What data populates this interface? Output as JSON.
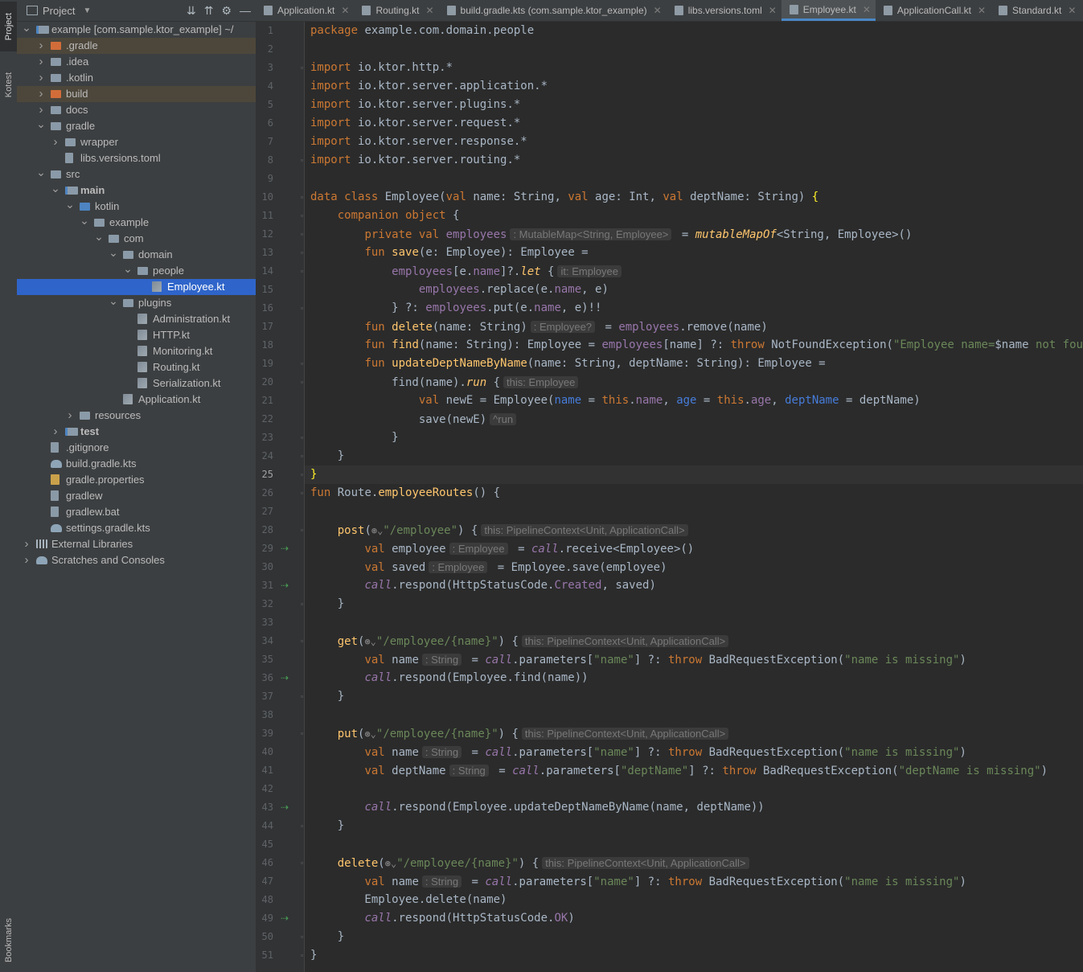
{
  "side_tabs": {
    "project": "Project",
    "kotest": "Kotest",
    "bookmarks": "Bookmarks"
  },
  "project_panel": {
    "title": "Project",
    "tree": [
      {
        "label": "example [com.sample.ktor_example]  ~/",
        "depth": 0,
        "arrow": "open",
        "icon": "module"
      },
      {
        "label": ".gradle",
        "depth": 1,
        "arrow": "closed",
        "icon": "folder-excluded",
        "excluded": true
      },
      {
        "label": ".idea",
        "depth": 1,
        "arrow": "closed",
        "icon": "folder"
      },
      {
        "label": ".kotlin",
        "depth": 1,
        "arrow": "closed",
        "icon": "folder"
      },
      {
        "label": "build",
        "depth": 1,
        "arrow": "closed",
        "icon": "folder-excluded",
        "excluded": true
      },
      {
        "label": "docs",
        "depth": 1,
        "arrow": "closed",
        "icon": "folder"
      },
      {
        "label": "gradle",
        "depth": 1,
        "arrow": "open",
        "icon": "folder"
      },
      {
        "label": "wrapper",
        "depth": 2,
        "arrow": "closed",
        "icon": "folder"
      },
      {
        "label": "libs.versions.toml",
        "depth": 2,
        "arrow": "none",
        "icon": "file"
      },
      {
        "label": "src",
        "depth": 1,
        "arrow": "open",
        "icon": "folder"
      },
      {
        "label": "main",
        "depth": 2,
        "arrow": "open",
        "icon": "folder-module",
        "bold": true
      },
      {
        "label": "kotlin",
        "depth": 3,
        "arrow": "open",
        "icon": "folder-source"
      },
      {
        "label": "example",
        "depth": 4,
        "arrow": "open",
        "icon": "folder"
      },
      {
        "label": "com",
        "depth": 5,
        "arrow": "open",
        "icon": "folder"
      },
      {
        "label": "domain",
        "depth": 6,
        "arrow": "open",
        "icon": "folder"
      },
      {
        "label": "people",
        "depth": 7,
        "arrow": "open",
        "icon": "folder"
      },
      {
        "label": "Employee.kt",
        "depth": 8,
        "arrow": "none",
        "icon": "kotlin-file",
        "selected": true
      },
      {
        "label": "plugins",
        "depth": 6,
        "arrow": "open",
        "icon": "folder"
      },
      {
        "label": "Administration.kt",
        "depth": 7,
        "arrow": "none",
        "icon": "kotlin-file"
      },
      {
        "label": "HTTP.kt",
        "depth": 7,
        "arrow": "none",
        "icon": "kotlin-file"
      },
      {
        "label": "Monitoring.kt",
        "depth": 7,
        "arrow": "none",
        "icon": "kotlin-file"
      },
      {
        "label": "Routing.kt",
        "depth": 7,
        "arrow": "none",
        "icon": "kotlin-file"
      },
      {
        "label": "Serialization.kt",
        "depth": 7,
        "arrow": "none",
        "icon": "kotlin-file"
      },
      {
        "label": "Application.kt",
        "depth": 6,
        "arrow": "none",
        "icon": "kotlin-file"
      },
      {
        "label": "resources",
        "depth": 3,
        "arrow": "closed",
        "icon": "folder-resources"
      },
      {
        "label": "test",
        "depth": 2,
        "arrow": "closed",
        "icon": "folder-module",
        "bold": true
      },
      {
        "label": ".gitignore",
        "depth": 1,
        "arrow": "none",
        "icon": "file"
      },
      {
        "label": "build.gradle.kts",
        "depth": 1,
        "arrow": "none",
        "icon": "gradle-file"
      },
      {
        "label": "gradle.properties",
        "depth": 1,
        "arrow": "none",
        "icon": "properties-file"
      },
      {
        "label": "gradlew",
        "depth": 1,
        "arrow": "none",
        "icon": "file"
      },
      {
        "label": "gradlew.bat",
        "depth": 1,
        "arrow": "none",
        "icon": "file"
      },
      {
        "label": "settings.gradle.kts",
        "depth": 1,
        "arrow": "none",
        "icon": "gradle-file"
      },
      {
        "label": "External Libraries",
        "depth": 0,
        "arrow": "closed",
        "icon": "library"
      },
      {
        "label": "Scratches and Consoles",
        "depth": 0,
        "arrow": "closed",
        "icon": "scratches"
      }
    ]
  },
  "tabs": [
    {
      "label": "Application.kt",
      "active": false
    },
    {
      "label": "Routing.kt",
      "active": false
    },
    {
      "label": "build.gradle.kts (com.sample.ktor_example)",
      "active": false
    },
    {
      "label": "libs.versions.toml",
      "active": false
    },
    {
      "label": "Employee.kt",
      "active": true
    },
    {
      "label": "ApplicationCall.kt",
      "active": false
    },
    {
      "label": "Standard.kt",
      "active": false
    }
  ],
  "editor": {
    "current_line": 25,
    "run_lines": [
      29,
      31,
      36,
      43,
      49
    ],
    "fold_lines": [
      3,
      8,
      10,
      11,
      12,
      13,
      14,
      16,
      19,
      20,
      23,
      24,
      25,
      26,
      28,
      32,
      34,
      37,
      39,
      44,
      46,
      50,
      51
    ],
    "lines": [
      [
        [
          "kw",
          "package"
        ],
        [
          "t",
          " example.com.domain.people"
        ]
      ],
      [],
      [
        [
          "kw",
          "import"
        ],
        [
          "t",
          " io.ktor.http.*"
        ]
      ],
      [
        [
          "kw",
          "import"
        ],
        [
          "t",
          " io.ktor.server.application.*"
        ]
      ],
      [
        [
          "kw",
          "import"
        ],
        [
          "t",
          " io.ktor.server.plugins.*"
        ]
      ],
      [
        [
          "kw",
          "import"
        ],
        [
          "t",
          " io.ktor.server.request.*"
        ]
      ],
      [
        [
          "kw",
          "import"
        ],
        [
          "t",
          " io.ktor.server.response.*"
        ]
      ],
      [
        [
          "kw",
          "import"
        ],
        [
          "t",
          " io.ktor.server.routing.*"
        ]
      ],
      [],
      [
        [
          "kw",
          "data class"
        ],
        [
          "t",
          " Employee("
        ],
        [
          "kw",
          "val"
        ],
        [
          "t",
          " name: String, "
        ],
        [
          "kw",
          "val"
        ],
        [
          "t",
          " age: Int, "
        ],
        [
          "kw",
          "val"
        ],
        [
          "t",
          " deptName: String) "
        ],
        [
          "br",
          "{"
        ]
      ],
      [
        [
          "t",
          "    "
        ],
        [
          "kw",
          "companion object"
        ],
        [
          "t",
          " {"
        ]
      ],
      [
        [
          "t",
          "        "
        ],
        [
          "kw",
          "private val"
        ],
        [
          "t",
          " "
        ],
        [
          "field",
          "employees"
        ],
        [
          "hint",
          ": MutableMap<String, Employee>"
        ],
        [
          "t",
          " = "
        ],
        [
          "fnit",
          "mutableMapOf"
        ],
        [
          "t",
          "<String, Employee>()"
        ]
      ],
      [
        [
          "t",
          "        "
        ],
        [
          "kw",
          "fun"
        ],
        [
          "t",
          " "
        ],
        [
          "fn",
          "save"
        ],
        [
          "t",
          "(e: Employee): Employee ="
        ]
      ],
      [
        [
          "t",
          "            "
        ],
        [
          "field",
          "employees"
        ],
        [
          "t",
          "[e."
        ],
        [
          "field",
          "name"
        ],
        [
          "t",
          "]?."
        ],
        [
          "fnit",
          "let"
        ],
        [
          "t",
          " {"
        ],
        [
          "hint",
          "it: Employee"
        ]
      ],
      [
        [
          "t",
          "                "
        ],
        [
          "field",
          "employees"
        ],
        [
          "t",
          ".replace(e."
        ],
        [
          "field",
          "name"
        ],
        [
          "t",
          ", e)"
        ]
      ],
      [
        [
          "t",
          "            } ?: "
        ],
        [
          "field",
          "employees"
        ],
        [
          "t",
          ".put(e."
        ],
        [
          "field",
          "name"
        ],
        [
          "t",
          ", e)!!"
        ]
      ],
      [
        [
          "t",
          "        "
        ],
        [
          "kw",
          "fun"
        ],
        [
          "t",
          " "
        ],
        [
          "fn",
          "delete"
        ],
        [
          "t",
          "(name: String)"
        ],
        [
          "hint",
          ": Employee?"
        ],
        [
          "t",
          " = "
        ],
        [
          "field",
          "employees"
        ],
        [
          "t",
          ".remove(name)"
        ]
      ],
      [
        [
          "t",
          "        "
        ],
        [
          "kw",
          "fun"
        ],
        [
          "t",
          " "
        ],
        [
          "fn",
          "find"
        ],
        [
          "t",
          "(name: String): Employee = "
        ],
        [
          "field",
          "employees"
        ],
        [
          "t",
          "[name] ?: "
        ],
        [
          "kw",
          "throw"
        ],
        [
          "t",
          " NotFoundException("
        ],
        [
          "str",
          "\"Employee name="
        ],
        [
          "t",
          "$name"
        ],
        [
          "str",
          " not found\""
        ],
        [
          "t",
          ")"
        ]
      ],
      [
        [
          "t",
          "        "
        ],
        [
          "kw",
          "fun"
        ],
        [
          "t",
          " "
        ],
        [
          "fn",
          "updateDeptNameByName"
        ],
        [
          "t",
          "(name: String, deptName: String): Employee ="
        ]
      ],
      [
        [
          "t",
          "            find(name)."
        ],
        [
          "fnit",
          "run"
        ],
        [
          "t",
          " {"
        ],
        [
          "hint",
          "this: Employee"
        ]
      ],
      [
        [
          "t",
          "                "
        ],
        [
          "kw",
          "val"
        ],
        [
          "t",
          " newE = Employee("
        ],
        [
          "param",
          "name"
        ],
        [
          "t",
          " = "
        ],
        [
          "kw",
          "this"
        ],
        [
          "t",
          "."
        ],
        [
          "field",
          "name"
        ],
        [
          "t",
          ", "
        ],
        [
          "param",
          "age"
        ],
        [
          "t",
          " = "
        ],
        [
          "kw",
          "this"
        ],
        [
          "t",
          "."
        ],
        [
          "field",
          "age"
        ],
        [
          "t",
          ", "
        ],
        [
          "param",
          "deptName"
        ],
        [
          "t",
          " = deptName)"
        ]
      ],
      [
        [
          "t",
          "                save(newE)"
        ],
        [
          "hint",
          "^run"
        ]
      ],
      [
        [
          "t",
          "            }"
        ]
      ],
      [
        [
          "t",
          "    }"
        ]
      ],
      [
        [
          "br",
          "}"
        ]
      ],
      [
        [
          "kw",
          "fun"
        ],
        [
          "t",
          " Route."
        ],
        [
          "fn",
          "employeeRoutes"
        ],
        [
          "t",
          "() {"
        ]
      ],
      [],
      [
        [
          "t",
          "    "
        ],
        [
          "fn2",
          "post"
        ],
        [
          "t",
          "("
        ],
        [
          "globe",
          "⊛⌄"
        ],
        [
          "str",
          "\"/employee\""
        ],
        [
          "t",
          ") {"
        ],
        [
          "hint",
          "this: PipelineContext<Unit, ApplicationCall>"
        ]
      ],
      [
        [
          "t",
          "        "
        ],
        [
          "kw",
          "val"
        ],
        [
          "t",
          " employee"
        ],
        [
          "hint",
          ": Employee"
        ],
        [
          "t",
          " = "
        ],
        [
          "callit",
          "call"
        ],
        [
          "t",
          ".receive<Employee>()"
        ]
      ],
      [
        [
          "t",
          "        "
        ],
        [
          "kw",
          "val"
        ],
        [
          "t",
          " saved"
        ],
        [
          "hint",
          ": Employee"
        ],
        [
          "t",
          " = Employee.save(employee)"
        ]
      ],
      [
        [
          "t",
          "        "
        ],
        [
          "callit",
          "call"
        ],
        [
          "t",
          ".respond(HttpStatusCode."
        ],
        [
          "field",
          "Created"
        ],
        [
          "t",
          ", saved)"
        ]
      ],
      [
        [
          "t",
          "    }"
        ]
      ],
      [],
      [
        [
          "t",
          "    "
        ],
        [
          "fn2",
          "get"
        ],
        [
          "t",
          "("
        ],
        [
          "globe",
          "⊛⌄"
        ],
        [
          "str",
          "\"/employee/{name}\""
        ],
        [
          "t",
          ") {"
        ],
        [
          "hint",
          "this: PipelineContext<Unit, ApplicationCall>"
        ]
      ],
      [
        [
          "t",
          "        "
        ],
        [
          "kw",
          "val"
        ],
        [
          "t",
          " name"
        ],
        [
          "hint",
          ": String"
        ],
        [
          "t",
          " = "
        ],
        [
          "callit",
          "call"
        ],
        [
          "t",
          ".parameters["
        ],
        [
          "str",
          "\"name\""
        ],
        [
          "t",
          "] ?: "
        ],
        [
          "kw",
          "throw"
        ],
        [
          "t",
          " BadRequestException("
        ],
        [
          "str",
          "\"name is missing\""
        ],
        [
          "t",
          ")"
        ]
      ],
      [
        [
          "t",
          "        "
        ],
        [
          "callit",
          "call"
        ],
        [
          "t",
          ".respond(Employee.find(name))"
        ]
      ],
      [
        [
          "t",
          "    }"
        ]
      ],
      [],
      [
        [
          "t",
          "    "
        ],
        [
          "fn2",
          "put"
        ],
        [
          "t",
          "("
        ],
        [
          "globe",
          "⊛⌄"
        ],
        [
          "str",
          "\"/employee/{name}\""
        ],
        [
          "t",
          ") {"
        ],
        [
          "hint",
          "this: PipelineContext<Unit, ApplicationCall>"
        ]
      ],
      [
        [
          "t",
          "        "
        ],
        [
          "kw",
          "val"
        ],
        [
          "t",
          " name"
        ],
        [
          "hint",
          ": String"
        ],
        [
          "t",
          " = "
        ],
        [
          "callit",
          "call"
        ],
        [
          "t",
          ".parameters["
        ],
        [
          "str",
          "\"name\""
        ],
        [
          "t",
          "] ?: "
        ],
        [
          "kw",
          "throw"
        ],
        [
          "t",
          " BadRequestException("
        ],
        [
          "str",
          "\"name is missing\""
        ],
        [
          "t",
          ")"
        ]
      ],
      [
        [
          "t",
          "        "
        ],
        [
          "kw",
          "val"
        ],
        [
          "t",
          " deptName"
        ],
        [
          "hint",
          ": String"
        ],
        [
          "t",
          " = "
        ],
        [
          "callit",
          "call"
        ],
        [
          "t",
          ".parameters["
        ],
        [
          "str",
          "\"deptName\""
        ],
        [
          "t",
          "] ?: "
        ],
        [
          "kw",
          "throw"
        ],
        [
          "t",
          " BadRequestException("
        ],
        [
          "str",
          "\"deptName is missing\""
        ],
        [
          "t",
          ")"
        ]
      ],
      [],
      [
        [
          "t",
          "        "
        ],
        [
          "callit",
          "call"
        ],
        [
          "t",
          ".respond(Employee.updateDeptNameByName(name, deptName))"
        ]
      ],
      [
        [
          "t",
          "    }"
        ]
      ],
      [],
      [
        [
          "t",
          "    "
        ],
        [
          "fn2",
          "delete"
        ],
        [
          "t",
          "("
        ],
        [
          "globe",
          "⊛⌄"
        ],
        [
          "str",
          "\"/employee/{name}\""
        ],
        [
          "t",
          ") {"
        ],
        [
          "hint",
          "this: PipelineContext<Unit, ApplicationCall>"
        ]
      ],
      [
        [
          "t",
          "        "
        ],
        [
          "kw",
          "val"
        ],
        [
          "t",
          " name"
        ],
        [
          "hint",
          ": String"
        ],
        [
          "t",
          " = "
        ],
        [
          "callit",
          "call"
        ],
        [
          "t",
          ".parameters["
        ],
        [
          "str",
          "\"name\""
        ],
        [
          "t",
          "] ?: "
        ],
        [
          "kw",
          "throw"
        ],
        [
          "t",
          " BadRequestException("
        ],
        [
          "str",
          "\"name is missing\""
        ],
        [
          "t",
          ")"
        ]
      ],
      [
        [
          "t",
          "        Employee.delete(name)"
        ]
      ],
      [
        [
          "t",
          "        "
        ],
        [
          "callit",
          "call"
        ],
        [
          "t",
          ".respond(HttpStatusCode."
        ],
        [
          "field",
          "OK"
        ],
        [
          "t",
          ")"
        ]
      ],
      [
        [
          "t",
          "    }"
        ]
      ],
      [
        [
          "t",
          "}"
        ]
      ]
    ]
  }
}
